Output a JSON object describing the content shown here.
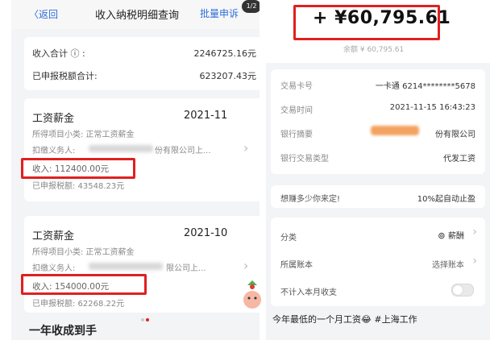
{
  "left": {
    "back_label": "〈返回",
    "title": "收入纳税明细查询",
    "bulk_label": "批量申诉",
    "page_badge": "1/2",
    "summary": {
      "income_total_label": "收入合计 ⓘ :",
      "income_total_value": "2246725.16元",
      "tax_declared_label": "已申报税额合计:",
      "tax_declared_value": "623207.43元"
    },
    "records": [
      {
        "title": "工资薪金",
        "date": "2021-11",
        "subitem": "所得项目小类: 正常工资薪金",
        "withholder": "扣缴义务人:",
        "withholder_tail": "份有限公司上...",
        "income": "收入: 112400.00元",
        "tax": "已申报税额: 43548.23元"
      },
      {
        "title": "工资薪金",
        "date": "2021-10",
        "subitem": "所得项目小类: 正常工资薪金",
        "withholder": "扣缴义务人:",
        "withholder_tail": "限公司上...",
        "income": "收入: 154000.00元",
        "tax": "已申报税额: 62268.22元"
      }
    ],
    "bottom_text": "一年收成到手"
  },
  "right": {
    "amount": "+ ¥60,795.61",
    "balance": "余额 ¥ 60,795.61",
    "details": [
      {
        "label": "交易卡号",
        "value": "一卡通 6214********5678"
      },
      {
        "label": "交易时间",
        "value": "2021-11-15 16:43:23"
      },
      {
        "label": "银行摘要",
        "value": "份有限公司"
      },
      {
        "label": "银行交易类型",
        "value": "代发工资"
      }
    ],
    "promo_left": "想赚多少你来定!",
    "promo_right": "10%起自动止盈",
    "category_label": "分类",
    "category_value": "薪酬",
    "account_label": "所属账本",
    "account_value": "选择账本",
    "exclude_label": "不计入本月收支",
    "caption": "今年最低的一个月工资😂 #上海工作"
  },
  "colors": {
    "accent": "#2f6fd6",
    "highlight": "#e02020"
  }
}
